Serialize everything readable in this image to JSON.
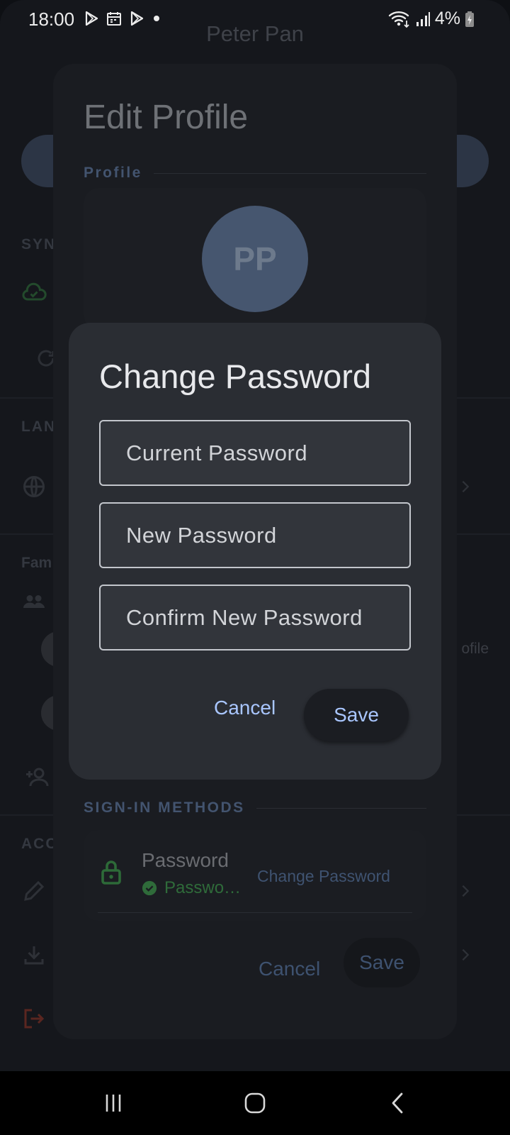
{
  "status_bar": {
    "time": "18:00",
    "battery": "4%",
    "left_icons": [
      "play-store-icon",
      "calendar-icon",
      "play-store-icon",
      "notification-dot-icon"
    ],
    "right_icons": [
      "wifi-icon",
      "signal-icon",
      "battery-charging-icon"
    ]
  },
  "background": {
    "user_name": "Peter Pan",
    "section_labels": [
      "SYN",
      "LAN",
      "Fam",
      "ACC"
    ],
    "partial_text": "ofile"
  },
  "edit_profile": {
    "title": "Edit Profile",
    "profile_section_label": "Profile",
    "avatar_initials": "PP",
    "signin_section_label": "SIGN-IN METHODS",
    "password_method": {
      "title": "Password",
      "status": "Passwo…",
      "change_link": "Change Password"
    },
    "cancel_label": "Cancel",
    "save_label": "Save"
  },
  "change_password": {
    "title": "Change Password",
    "fields": {
      "current_placeholder": "Current Password",
      "new_placeholder": "New Password",
      "confirm_placeholder": "Confirm New Password"
    },
    "cancel_label": "Cancel",
    "save_label": "Save"
  },
  "colors": {
    "accent": "#a9c6ff",
    "dialog_surface": "#2a2d33",
    "success_green": "#2f6b3a"
  }
}
